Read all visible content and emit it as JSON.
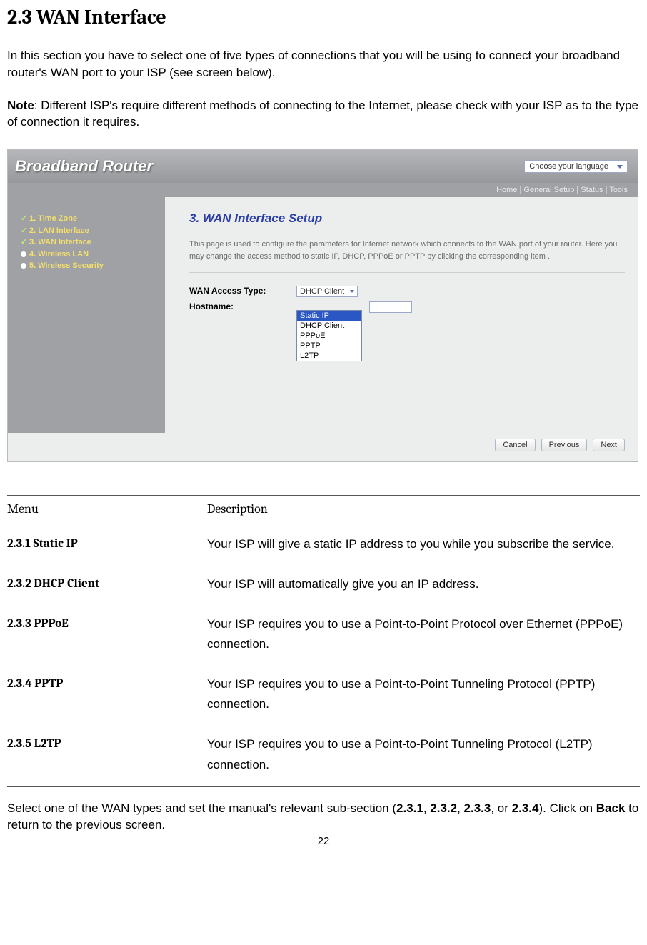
{
  "heading": "2.3 WAN Interface",
  "intro": "In this section you have to select one of five types of connections that you will be using to connect your broadband router's WAN port to your ISP (see screen below).",
  "note_label": "Note",
  "note_colon": ": ",
  "note_body": "Different ISP's require different methods of connecting to the Internet, please check with your ISP as to the type of connection it requires.",
  "screenshot": {
    "brand": "Broadband Router",
    "lang": "Choose your language",
    "links": {
      "home": "Home",
      "general": "General Setup",
      "status": "Status",
      "tools": "Tools",
      "sep": " | "
    },
    "sidebar": [
      {
        "label": "1. Time Zone",
        "marker": "check"
      },
      {
        "label": "2. LAN Interface",
        "marker": "check"
      },
      {
        "label": "3. WAN Interface",
        "marker": "check"
      },
      {
        "label": "4. Wireless LAN",
        "marker": "dot"
      },
      {
        "label": "5. Wireless Security",
        "marker": "dot"
      }
    ],
    "main_title": "3. WAN Interface Setup",
    "main_desc": "This page is used to configure the parameters for Internet network which connects to the WAN port of your router. Here you may change the access method to static IP, DHCP, PPPoE or PPTP by clicking the corresponding item .",
    "wan_label": "WAN Access Type:",
    "host_label": "Hostname:",
    "wan_selected": "DHCP Client",
    "wan_options": [
      "Static IP",
      "DHCP Client",
      "PPPoE",
      "PPTP",
      "L2TP"
    ],
    "buttons": {
      "cancel": "Cancel",
      "prev": "Previous",
      "next": "Next"
    }
  },
  "table": {
    "head_menu": "Menu",
    "head_desc": "Description",
    "rows": [
      {
        "menu": "2.3.1 Static IP",
        "desc": "Your ISP will give a static IP address to you while you subscribe the service."
      },
      {
        "menu": "2.3.2 DHCP Client",
        "desc": "Your ISP will automatically give you an IP address."
      },
      {
        "menu": "2.3.3 PPPoE",
        "desc": "Your ISP requires you to use a Point-to-Point Protocol over Ethernet (PPPoE) connection."
      },
      {
        "menu": "2.3.4 PPTP",
        "desc": "Your ISP requires you to use a Point-to-Point Tunneling Protocol (PPTP) connection."
      },
      {
        "menu": "2.3.5 L2TP",
        "desc": "Your ISP requires you to use a Point-to-Point Tunneling Protocol (L2TP) connection."
      }
    ]
  },
  "outro_1a": "Select one of the WAN types and set the manual's relevant sub-section (",
  "outro_b1": "2.3.1",
  "outro_c": ", ",
  "outro_b2": "2.3.2",
  "outro_b3": "2.3.3",
  "outro_or": ", or ",
  "outro_b4": "2.3.4",
  "outro_2a": "). Click on ",
  "outro_back": "Back",
  "outro_2b": " to return to the previous screen.",
  "page_number": "22"
}
